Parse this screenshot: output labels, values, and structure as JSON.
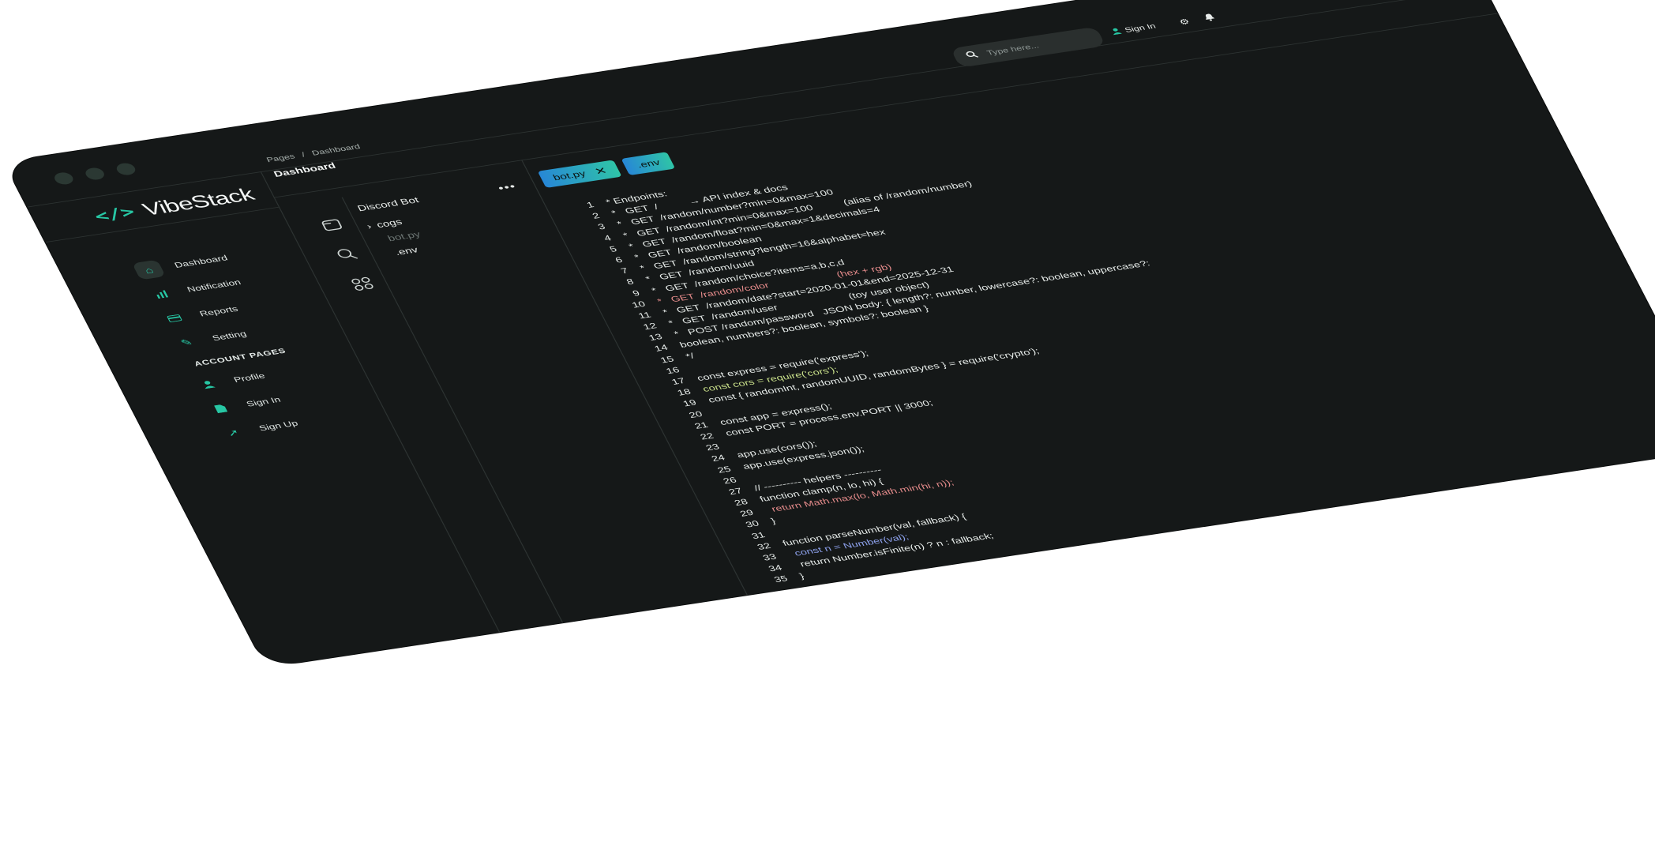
{
  "window": {
    "dots": [
      "dot-1",
      "dot-2",
      "dot-3"
    ]
  },
  "brand": {
    "logo": "</>",
    "name": "VibeStack"
  },
  "sidebar": {
    "items": [
      {
        "label": "Dashboard",
        "icon": "home-icon",
        "active": true
      },
      {
        "label": "Notification",
        "icon": "bar-chart-icon"
      },
      {
        "label": "Reports",
        "icon": "credit-card-icon"
      },
      {
        "label": "Setting",
        "icon": "wrench-icon"
      }
    ],
    "section_title": "ACCOUNT PAGES",
    "account_items": [
      {
        "label": "Profile",
        "icon": "person-icon"
      },
      {
        "label": "Sign In",
        "icon": "document-icon"
      },
      {
        "label": "Sign Up",
        "icon": "rocket-icon"
      }
    ]
  },
  "header": {
    "breadcrumb": {
      "root": "Pages",
      "sep": "/",
      "current": "Dashboard"
    },
    "title": "Dashboard",
    "search_placeholder": "Type here...",
    "signin_label": "Sign In",
    "icons": [
      "gear-icon",
      "bell-icon"
    ]
  },
  "rail": {
    "icons": [
      "files-icon",
      "search-icon",
      "extensions-icon"
    ]
  },
  "tree": {
    "title": "Discord Bot",
    "more": "•••",
    "items": [
      {
        "label": "cogs",
        "type": "folder",
        "chevron": "›"
      },
      {
        "label": "bot.py",
        "type": "file-dim"
      },
      {
        "label": ".env",
        "type": "file"
      }
    ]
  },
  "tabs": [
    {
      "label": "bot.py",
      "close": "✕"
    },
    {
      "label": ".env"
    }
  ],
  "code": {
    "lines": [
      {
        "n": "1",
        "t": " * Endpoints:"
      },
      {
        "n": "2",
        "t": " *   GET  /          → API index & docs"
      },
      {
        "n": "3",
        "t": " *   GET  /random/number?min=0&max=100"
      },
      {
        "n": "4",
        "t": " *   GET  /random/int?min=0&max=100          (alias of /random/number)"
      },
      {
        "n": "5",
        "t": " *   GET  /random/float?min=0&max=1&decimals=4"
      },
      {
        "n": "6",
        "t": " *   GET  /random/boolean"
      },
      {
        "n": "7",
        "t": " *   GET  /random/string?length=16&alphabet=hex"
      },
      {
        "n": "8",
        "t": " *   GET  /random/uuid"
      },
      {
        "n": "9",
        "t": " *   GET  /random/choice?items=a,b,c,d"
      },
      {
        "n": "10",
        "t": " *   GET  /random/color                      (hex + rgb)",
        "style": "red"
      },
      {
        "n": "11",
        "t": " *   GET  /random/date?start=2020-01-01&end=2025-12-31"
      },
      {
        "n": "12",
        "t": " *   GET  /random/user                       (toy user object)"
      },
      {
        "n": "13",
        "t": " *   POST /random/password   JSON body: { length?: number, lowercase?: boolean, uppercase?:"
      },
      {
        "n": "14",
        "t": " boolean, numbers?: boolean, symbols?: boolean }"
      },
      {
        "n": "15",
        "t": " */"
      },
      {
        "n": "16",
        "t": ""
      },
      {
        "n": "17",
        "t": " const express = require('express');"
      },
      {
        "n": "18",
        "t": " const cors = require('cors');",
        "style": "green"
      },
      {
        "n": "19",
        "t": " const { randomInt, randomUUID, randomBytes } = require('crypto');"
      },
      {
        "n": "20",
        "t": ""
      },
      {
        "n": "21",
        "t": " const app = express();"
      },
      {
        "n": "22",
        "t": " const PORT = process.env.PORT || 3000;"
      },
      {
        "n": "23",
        "t": ""
      },
      {
        "n": "24",
        "t": " app.use(cors());"
      },
      {
        "n": "25",
        "t": " app.use(express.json());"
      },
      {
        "n": "26",
        "t": ""
      },
      {
        "n": "27",
        "t": " // ---------- helpers ----------"
      },
      {
        "n": "28",
        "t": " function clamp(n, lo, hi) {"
      },
      {
        "n": "29",
        "t": "   return Math.max(lo, Math.min(hi, n));",
        "style": "red"
      },
      {
        "n": "30",
        "t": " }"
      },
      {
        "n": "31",
        "t": ""
      },
      {
        "n": "32",
        "t": " function parseNumber(val, fallback) {"
      },
      {
        "n": "33",
        "t": "   const n = Number(val);",
        "style": "blue"
      },
      {
        "n": "34",
        "t": "   return Number.isFinite(n) ? n : fallback;"
      },
      {
        "n": "35",
        "t": " }"
      }
    ]
  },
  "colors": {
    "accent": "#27c7a4",
    "tab_gradient_start": "#2787d6",
    "tab_gradient_end": "#2fc4a7",
    "bg": "#151818"
  }
}
